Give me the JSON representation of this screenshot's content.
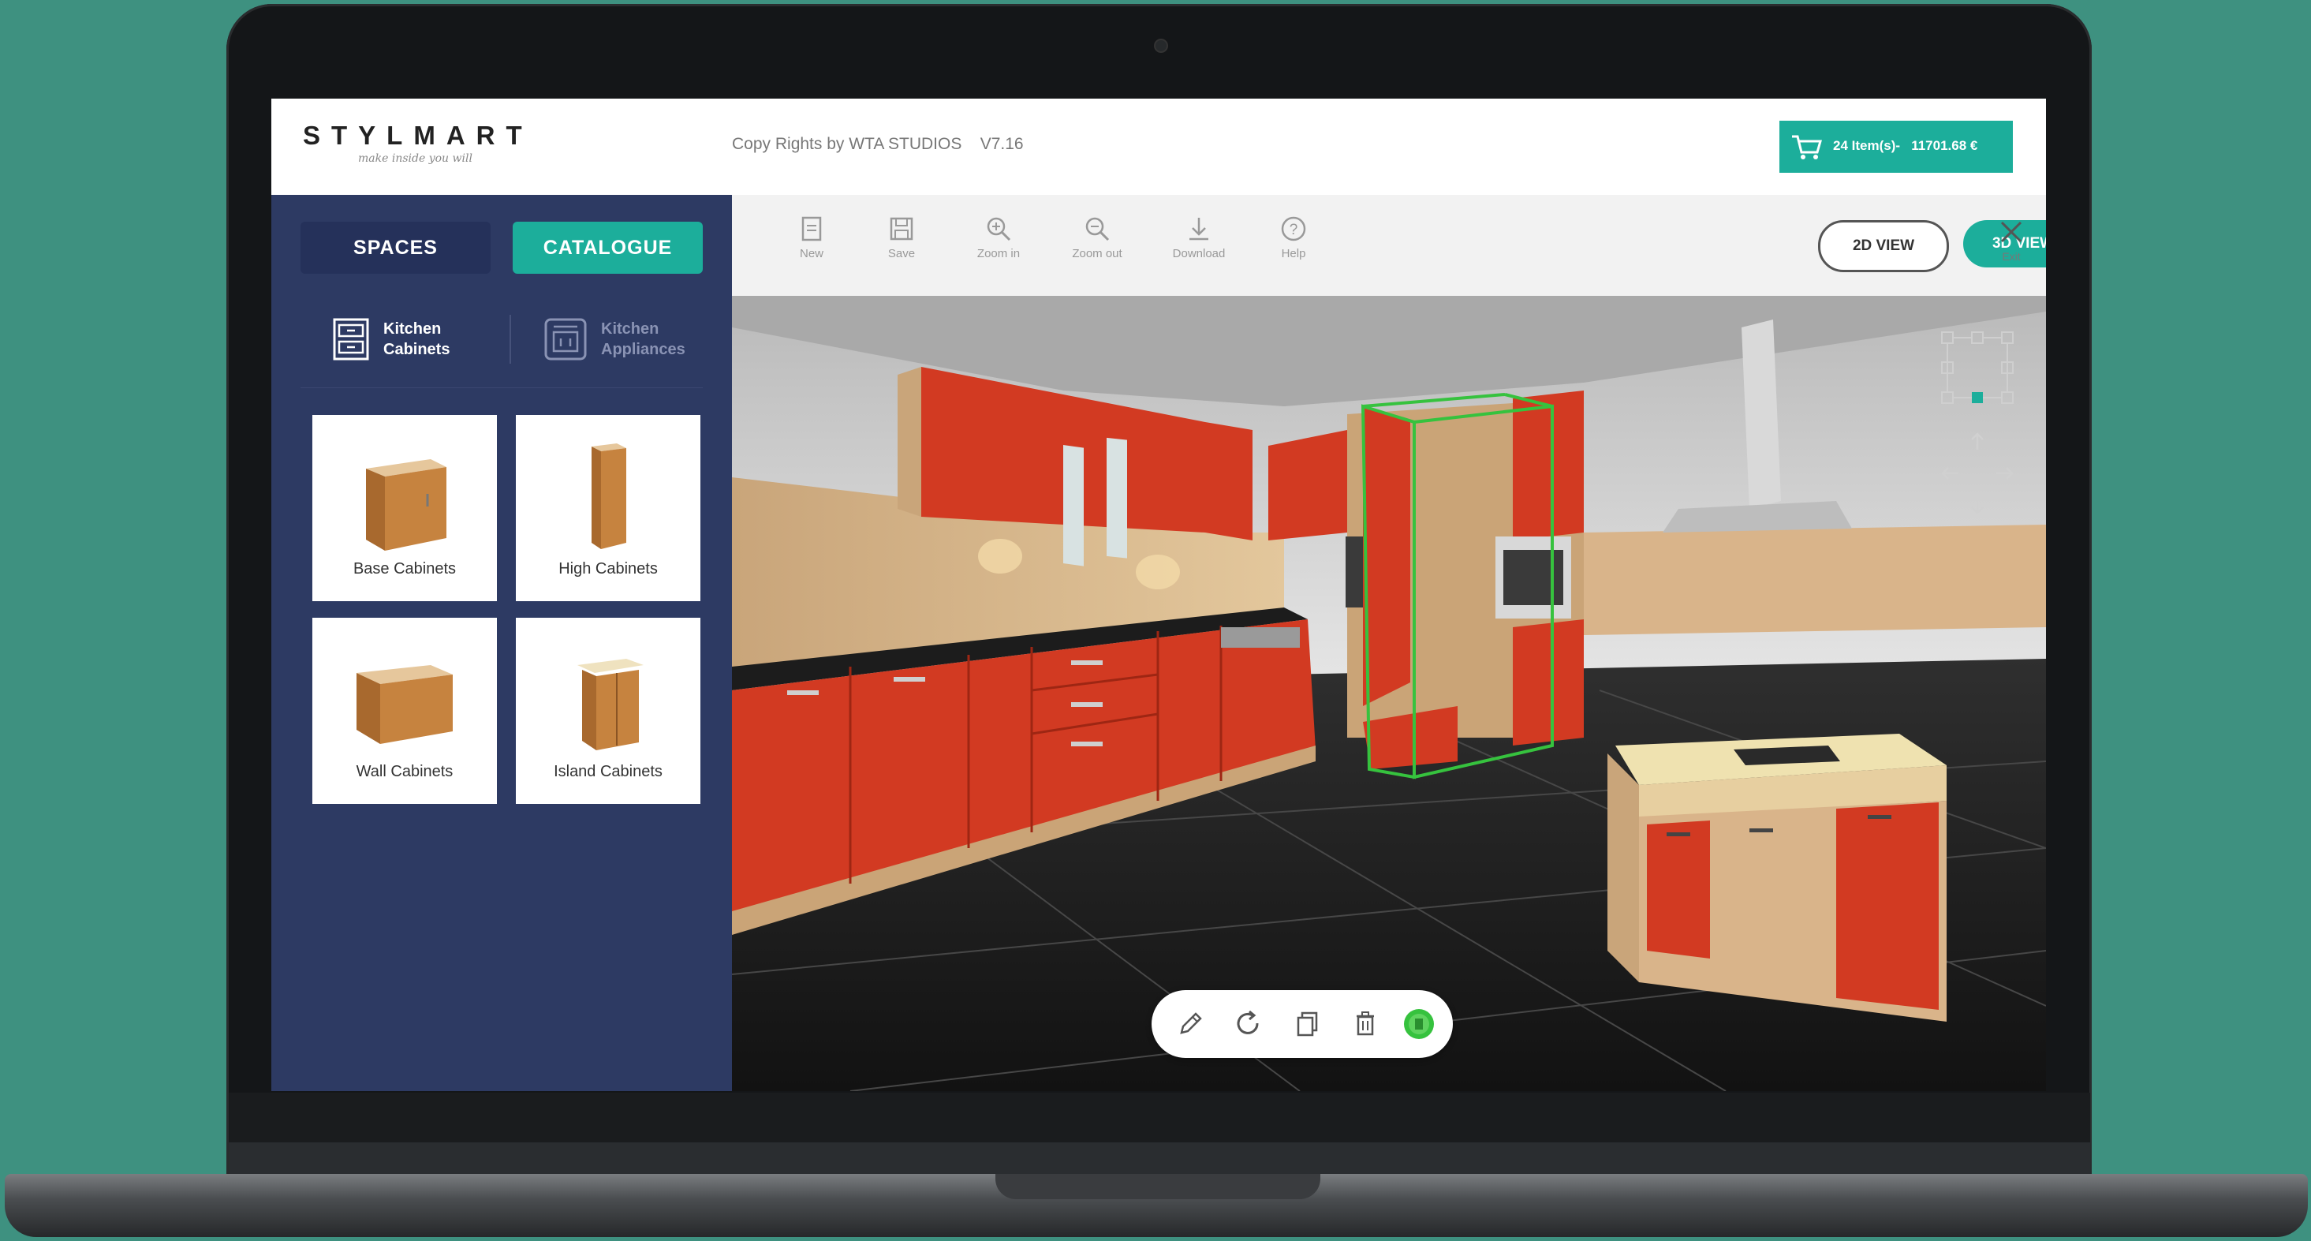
{
  "header": {
    "logo": "STYLMART",
    "tagline": "make inside you will",
    "copyright": "Copy Rights by WTA STUDIOS",
    "version": "V7.16",
    "cart": {
      "items_label": "24 Item(s)-",
      "total": "11701.68 €",
      "icon": "cart-icon"
    }
  },
  "sidebar": {
    "tabs": [
      {
        "label": "SPACES",
        "active": false
      },
      {
        "label": "CATALOGUE",
        "active": true
      }
    ],
    "subcategories": [
      {
        "label_line1": "Kitchen",
        "label_line2": "Cabinets",
        "icon": "cabinet-icon",
        "active": true
      },
      {
        "label_line1": "Kitchen",
        "label_line2": "Appliances",
        "icon": "appliance-icon",
        "active": false
      }
    ],
    "items": [
      {
        "label": "Base Cabinets"
      },
      {
        "label": "High Cabinets"
      },
      {
        "label": "Wall Cabinets"
      },
      {
        "label": "Island Cabinets"
      }
    ]
  },
  "toolbar": {
    "tools": [
      {
        "label": "New",
        "icon": "new-file-icon"
      },
      {
        "label": "Save",
        "icon": "save-icon"
      },
      {
        "label": "Zoom in",
        "icon": "zoom-in-icon"
      },
      {
        "label": "Zoom out",
        "icon": "zoom-out-icon"
      },
      {
        "label": "Download",
        "icon": "download-icon"
      },
      {
        "label": "Help",
        "icon": "help-icon"
      }
    ],
    "view_2d": "2D VIEW",
    "view_3d": "3D VIEW",
    "active_view": "3D VIEW",
    "exit_label": "Exit"
  },
  "selection_actions": [
    {
      "icon": "edit-icon"
    },
    {
      "icon": "rotate-icon"
    },
    {
      "icon": "duplicate-icon"
    },
    {
      "icon": "delete-icon"
    },
    {
      "icon": "confirm-icon"
    }
  ],
  "colors": {
    "accent": "#1cae9b",
    "sidebar": "#2d3a63",
    "cabinet_red": "#d23a22",
    "selection_green": "#36c23e"
  }
}
